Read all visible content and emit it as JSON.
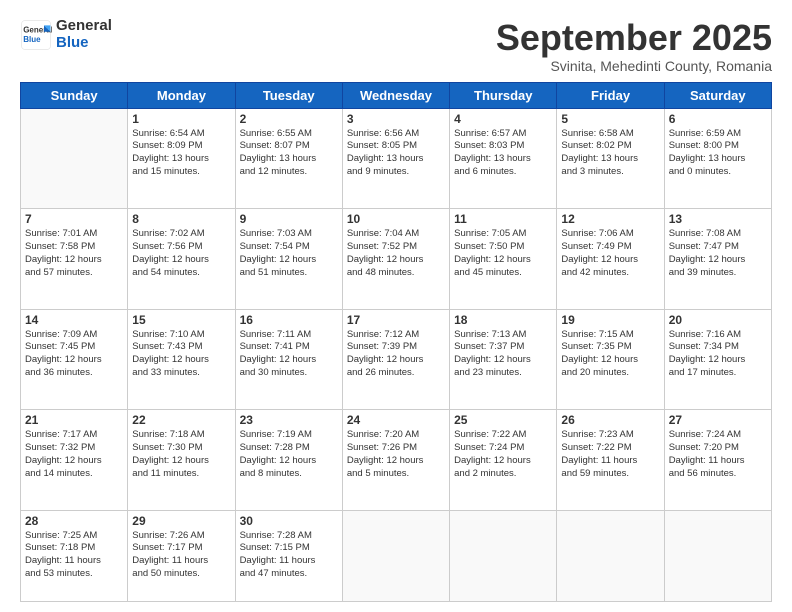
{
  "logo": {
    "general": "General",
    "blue": "Blue"
  },
  "header": {
    "month": "September 2025",
    "location": "Svinita, Mehedinti County, Romania"
  },
  "days": [
    "Sunday",
    "Monday",
    "Tuesday",
    "Wednesday",
    "Thursday",
    "Friday",
    "Saturday"
  ],
  "weeks": [
    [
      {
        "day": "",
        "info": ""
      },
      {
        "day": "1",
        "info": "Sunrise: 6:54 AM\nSunset: 8:09 PM\nDaylight: 13 hours\nand 15 minutes."
      },
      {
        "day": "2",
        "info": "Sunrise: 6:55 AM\nSunset: 8:07 PM\nDaylight: 13 hours\nand 12 minutes."
      },
      {
        "day": "3",
        "info": "Sunrise: 6:56 AM\nSunset: 8:05 PM\nDaylight: 13 hours\nand 9 minutes."
      },
      {
        "day": "4",
        "info": "Sunrise: 6:57 AM\nSunset: 8:03 PM\nDaylight: 13 hours\nand 6 minutes."
      },
      {
        "day": "5",
        "info": "Sunrise: 6:58 AM\nSunset: 8:02 PM\nDaylight: 13 hours\nand 3 minutes."
      },
      {
        "day": "6",
        "info": "Sunrise: 6:59 AM\nSunset: 8:00 PM\nDaylight: 13 hours\nand 0 minutes."
      }
    ],
    [
      {
        "day": "7",
        "info": "Sunrise: 7:01 AM\nSunset: 7:58 PM\nDaylight: 12 hours\nand 57 minutes."
      },
      {
        "day": "8",
        "info": "Sunrise: 7:02 AM\nSunset: 7:56 PM\nDaylight: 12 hours\nand 54 minutes."
      },
      {
        "day": "9",
        "info": "Sunrise: 7:03 AM\nSunset: 7:54 PM\nDaylight: 12 hours\nand 51 minutes."
      },
      {
        "day": "10",
        "info": "Sunrise: 7:04 AM\nSunset: 7:52 PM\nDaylight: 12 hours\nand 48 minutes."
      },
      {
        "day": "11",
        "info": "Sunrise: 7:05 AM\nSunset: 7:50 PM\nDaylight: 12 hours\nand 45 minutes."
      },
      {
        "day": "12",
        "info": "Sunrise: 7:06 AM\nSunset: 7:49 PM\nDaylight: 12 hours\nand 42 minutes."
      },
      {
        "day": "13",
        "info": "Sunrise: 7:08 AM\nSunset: 7:47 PM\nDaylight: 12 hours\nand 39 minutes."
      }
    ],
    [
      {
        "day": "14",
        "info": "Sunrise: 7:09 AM\nSunset: 7:45 PM\nDaylight: 12 hours\nand 36 minutes."
      },
      {
        "day": "15",
        "info": "Sunrise: 7:10 AM\nSunset: 7:43 PM\nDaylight: 12 hours\nand 33 minutes."
      },
      {
        "day": "16",
        "info": "Sunrise: 7:11 AM\nSunset: 7:41 PM\nDaylight: 12 hours\nand 30 minutes."
      },
      {
        "day": "17",
        "info": "Sunrise: 7:12 AM\nSunset: 7:39 PM\nDaylight: 12 hours\nand 26 minutes."
      },
      {
        "day": "18",
        "info": "Sunrise: 7:13 AM\nSunset: 7:37 PM\nDaylight: 12 hours\nand 23 minutes."
      },
      {
        "day": "19",
        "info": "Sunrise: 7:15 AM\nSunset: 7:35 PM\nDaylight: 12 hours\nand 20 minutes."
      },
      {
        "day": "20",
        "info": "Sunrise: 7:16 AM\nSunset: 7:34 PM\nDaylight: 12 hours\nand 17 minutes."
      }
    ],
    [
      {
        "day": "21",
        "info": "Sunrise: 7:17 AM\nSunset: 7:32 PM\nDaylight: 12 hours\nand 14 minutes."
      },
      {
        "day": "22",
        "info": "Sunrise: 7:18 AM\nSunset: 7:30 PM\nDaylight: 12 hours\nand 11 minutes."
      },
      {
        "day": "23",
        "info": "Sunrise: 7:19 AM\nSunset: 7:28 PM\nDaylight: 12 hours\nand 8 minutes."
      },
      {
        "day": "24",
        "info": "Sunrise: 7:20 AM\nSunset: 7:26 PM\nDaylight: 12 hours\nand 5 minutes."
      },
      {
        "day": "25",
        "info": "Sunrise: 7:22 AM\nSunset: 7:24 PM\nDaylight: 12 hours\nand 2 minutes."
      },
      {
        "day": "26",
        "info": "Sunrise: 7:23 AM\nSunset: 7:22 PM\nDaylight: 11 hours\nand 59 minutes."
      },
      {
        "day": "27",
        "info": "Sunrise: 7:24 AM\nSunset: 7:20 PM\nDaylight: 11 hours\nand 56 minutes."
      }
    ],
    [
      {
        "day": "28",
        "info": "Sunrise: 7:25 AM\nSunset: 7:18 PM\nDaylight: 11 hours\nand 53 minutes."
      },
      {
        "day": "29",
        "info": "Sunrise: 7:26 AM\nSunset: 7:17 PM\nDaylight: 11 hours\nand 50 minutes."
      },
      {
        "day": "30",
        "info": "Sunrise: 7:28 AM\nSunset: 7:15 PM\nDaylight: 11 hours\nand 47 minutes."
      },
      {
        "day": "",
        "info": ""
      },
      {
        "day": "",
        "info": ""
      },
      {
        "day": "",
        "info": ""
      },
      {
        "day": "",
        "info": ""
      }
    ]
  ]
}
